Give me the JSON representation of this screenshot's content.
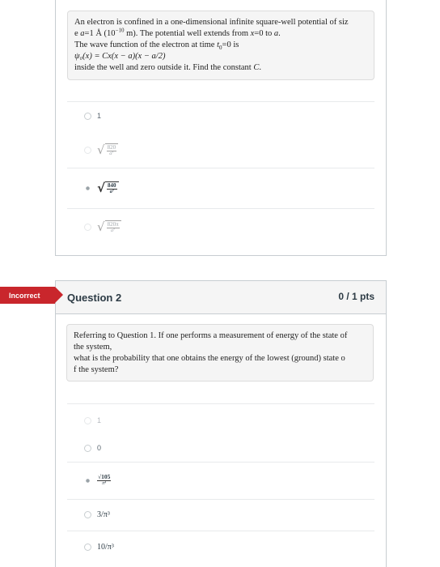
{
  "question1": {
    "prompt_line1a": "An electron is confined in a one-dimensional infinite square-well potential of siz",
    "prompt_line2_pre": "e ",
    "prompt_a_eq": "a",
    "prompt_eq1": "=1 Å (10",
    "prompt_exp": "−10",
    "prompt_m": " m). The potential well extends from ",
    "prompt_x": "x",
    "prompt_to": "=0 to ",
    "prompt_a2": "a",
    "prompt_dot": ".",
    "prompt_line3": "The wave function of the electron at time ",
    "prompt_t": "t",
    "prompt_t_sub": "0",
    "prompt_t_eq": "=0 is",
    "prompt_formula": "ψ₀(x) = Cx(x − a)(x − a/2)",
    "prompt_line5_pre": "inside the well and zero outside it. Find the constant ",
    "prompt_C": "C",
    "prompt_line5_post": ".",
    "answers": [
      {
        "label": "1"
      },
      {
        "num": "820",
        "den": "a⁷"
      },
      {
        "num": "840",
        "den": "a⁷"
      },
      {
        "num": "820π",
        "den": "a⁷"
      }
    ]
  },
  "question2": {
    "flag": "Incorrect",
    "title": "Question 2",
    "points": "0 / 1 pts",
    "prompt_line1": "Referring to Question 1. If one performs a measurement of energy of the state of",
    "prompt_line2": "the system,",
    "prompt_line3": "what is the probability  that one obtains the energy of the lowest (ground) state o",
    "prompt_line4": "f the system?",
    "answers": [
      {
        "label": "1"
      },
      {
        "label": "0"
      },
      {
        "num": "√105",
        "den": "π⁴"
      },
      {
        "label": "3/π³"
      },
      {
        "label": "10/π³"
      }
    ]
  }
}
